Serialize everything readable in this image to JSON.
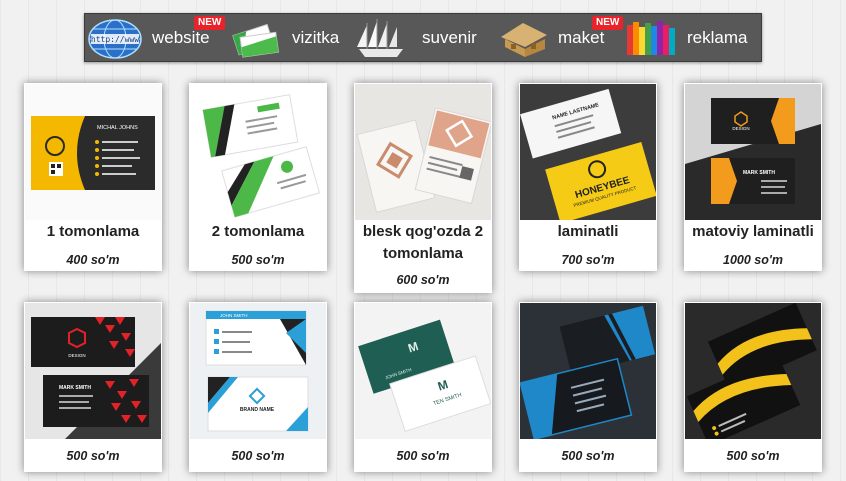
{
  "nav": {
    "items": [
      {
        "label": "website",
        "icon": "globe-www-icon",
        "badge": "NEW"
      },
      {
        "label": "vizitka",
        "icon": "business-cards-icon",
        "badge": ""
      },
      {
        "label": "suvenir",
        "icon": "sailing-ship-icon",
        "badge": ""
      },
      {
        "label": "maket",
        "icon": "house-model-icon",
        "badge": "NEW"
      },
      {
        "label": "reklama",
        "icon": "colorful-books-icon",
        "badge": ""
      }
    ]
  },
  "products": [
    {
      "title": "1 tomonlama",
      "price": "400 so'm"
    },
    {
      "title": "2 tomonlama",
      "price": "500 so'm"
    },
    {
      "title": "blesk qog'ozda 2 tomonlama",
      "price": "600 so'm"
    },
    {
      "title": "laminatli",
      "price": "700 so'm"
    },
    {
      "title": "matoviy laminatli",
      "price": "1000 so'm"
    },
    {
      "title": "",
      "price": "500 so'm"
    },
    {
      "title": "",
      "price": "500 so'm"
    },
    {
      "title": "",
      "price": "500 so'm"
    },
    {
      "title": "",
      "price": "500 so'm"
    },
    {
      "title": "",
      "price": "500 so'm"
    }
  ],
  "card_texts": {
    "c1_name": "MICHAL JOHNS",
    "c4_name": "NAME LASTNAME",
    "c4_brand": "HONEYBEE",
    "c4_sub": "PREMIUM QUALITY PRODUCT",
    "c5_name": "MARK SMITH",
    "c5_design": "DESIGN",
    "c6_name": "MARK SMITH",
    "c6_design": "DESIGN",
    "c7_name": "JOHN SMITH",
    "c7_brand": "BRAND NAME",
    "c8_name": "TEN SMITH",
    "c8_name2": "JOHN SMITH"
  },
  "colors": {
    "nav_bg": "#585858",
    "badge": "#e8232a",
    "page_bg": "#f1f1f1"
  }
}
